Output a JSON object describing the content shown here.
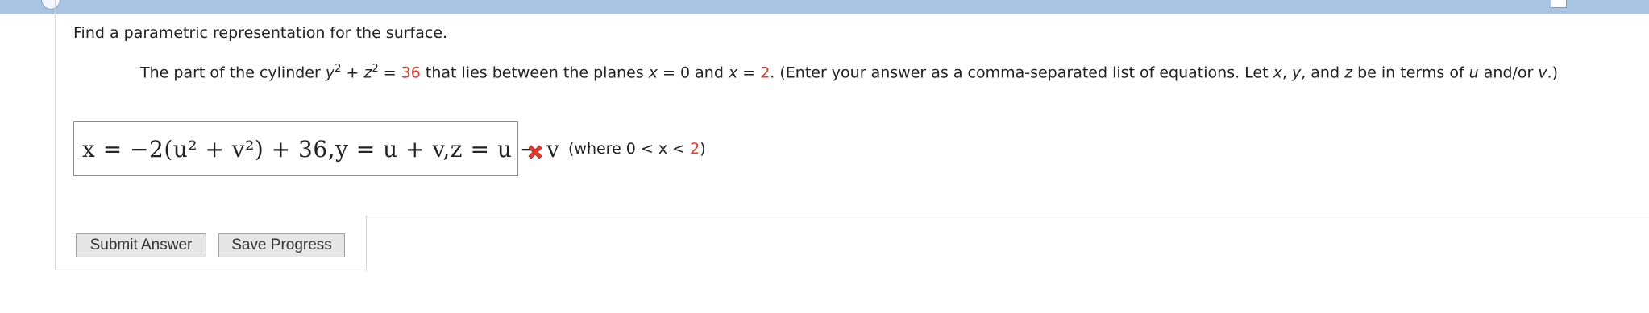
{
  "question": {
    "intro": "Find a parametric representation for the surface.",
    "problem_text_1": "The part of the cylinder ",
    "cyl_y": "y",
    "cyl_z": "z",
    "exp_2": "2",
    "plus": " + ",
    "equals": " = ",
    "radius_sq": "36",
    "problem_text_2": " that lies between the planes ",
    "x_var": "x",
    "eq0": " = 0 and ",
    "eq2_prefix": " = ",
    "x_end": "2",
    "problem_text_3": ". (Enter your answer as a comma-separated list of equations. Let ",
    "var_x": "x",
    "comma1": ", ",
    "var_y": "y",
    "and_text": ", and ",
    "var_z": "z",
    "problem_text_4": " be in terms of ",
    "var_u": "u",
    "andor": " and/or ",
    "var_v": "v",
    "problem_text_5": ".)"
  },
  "answer": {
    "value": "x = −2(u² + v²) + 36,y = u + v,z = u − v",
    "status_icon": "wrong-x-icon",
    "where_prefix": "(where 0 < x < ",
    "where_value": "2",
    "where_suffix": ")"
  },
  "buttons": {
    "submit": "Submit Answer",
    "save": "Save Progress"
  },
  "colors": {
    "accent_red": "#e23b2e",
    "topbar": "#a9c3e3"
  }
}
